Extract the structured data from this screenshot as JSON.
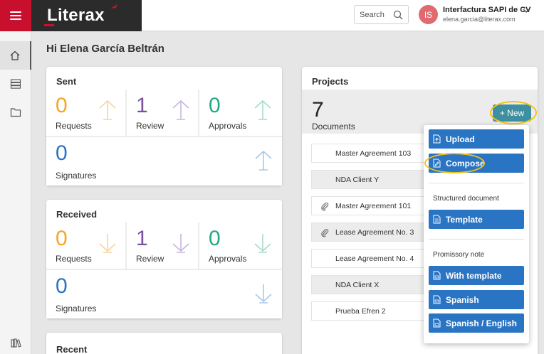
{
  "brand": {
    "name": "Literax",
    "accent": "#c8102e"
  },
  "search": {
    "placeholder": "Search"
  },
  "user": {
    "initials": "IS",
    "company": "Interfactura SAPI de CV",
    "email": "elena.garcia@literax.com"
  },
  "greeting": "Hi Elena García Beltrán",
  "sent": {
    "title": "Sent",
    "stats": [
      {
        "value": "0",
        "label": "Requests",
        "color": "#f5a623"
      },
      {
        "value": "1",
        "label": "Review",
        "color": "#7b4fa0"
      },
      {
        "value": "0",
        "label": "Approvals",
        "color": "#25a982"
      },
      {
        "value": "0",
        "label": "Signatures",
        "color": "#2a74c4"
      }
    ]
  },
  "received": {
    "title": "Received",
    "stats": [
      {
        "value": "0",
        "label": "Requests",
        "color": "#f5a623"
      },
      {
        "value": "1",
        "label": "Review",
        "color": "#7b4fa0"
      },
      {
        "value": "0",
        "label": "Approvals",
        "color": "#25a982"
      },
      {
        "value": "0",
        "label": "Signatures",
        "color": "#2a74c4"
      }
    ]
  },
  "recent": {
    "title": "Recent"
  },
  "projects": {
    "title": "Projects",
    "count": "7",
    "count_label": "Documents",
    "new_label": "+ New",
    "documents": [
      {
        "name": "Master Agreement 103",
        "attachment": false
      },
      {
        "name": "NDA Client Y",
        "attachment": false
      },
      {
        "name": "Master Agreement 101",
        "attachment": true
      },
      {
        "name": "Lease Agreement No. 3",
        "attachment": true
      },
      {
        "name": "Lease Agreement No. 4",
        "attachment": false
      },
      {
        "name": "NDA Client X",
        "attachment": false
      },
      {
        "name": "Prueba Efren 2",
        "attachment": false
      }
    ]
  },
  "new_menu": {
    "upload": "Upload",
    "compose": "Compose",
    "structured_heading": "Structured document",
    "template": "Template",
    "promissory_heading": "Promissory note",
    "with_template": "With template",
    "spanish": "Spanish",
    "spanish_english": "Spanish / English"
  },
  "icons": {
    "menu": "hamburger-icon",
    "search": "search-icon",
    "home": "home-icon",
    "list": "list-icon",
    "folder": "folder-icon",
    "books": "books-icon",
    "attachment": "paperclip-icon"
  },
  "highlight_color": "#f2c318"
}
